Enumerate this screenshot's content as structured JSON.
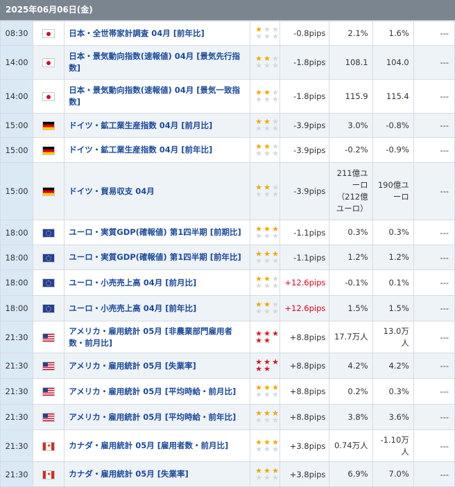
{
  "date_header": "2025年06月06日(金)",
  "colors": {
    "header_bg": "#7b8590",
    "time_bg": "#dbe9f5",
    "link": "#1a4a9c",
    "star": "#f0a800",
    "star_hot": "#d9121f",
    "positive_pips": "#e0001b"
  },
  "rows": [
    {
      "time": "08:30",
      "flag": "japan-flag-icon",
      "event": "日本・全世帯家計調査 04月 [前年比]",
      "stars": 1,
      "hot": false,
      "pips": "-0.8pips",
      "pips_up": false,
      "actual": "2.1%",
      "forecast": "1.6%",
      "prev": "---"
    },
    {
      "time": "14:00",
      "flag": "japan-flag-icon",
      "event": "日本・景気動向指数(速報値) 04月 [景気先行指数]",
      "stars": 2,
      "hot": false,
      "pips": "-1.8pips",
      "pips_up": false,
      "actual": "108.1",
      "forecast": "104.0",
      "prev": "---"
    },
    {
      "time": "14:00",
      "flag": "japan-flag-icon",
      "event": "日本・景気動向指数(速報値) 04月 [景気一致指数]",
      "stars": 2,
      "hot": false,
      "pips": "-1.8pips",
      "pips_up": false,
      "actual": "115.9",
      "forecast": "115.4",
      "prev": "---"
    },
    {
      "time": "15:00",
      "flag": "germany-flag-icon",
      "event": "ドイツ・鉱工業生産指数 04月 [前月比]",
      "stars": 2,
      "hot": false,
      "pips": "-3.9pips",
      "pips_up": false,
      "actual": "3.0%",
      "forecast": "-0.8%",
      "prev": "---"
    },
    {
      "time": "15:00",
      "flag": "germany-flag-icon",
      "event": "ドイツ・鉱工業生産指数 04月 [前年比]",
      "stars": 2,
      "hot": false,
      "pips": "-3.9pips",
      "pips_up": false,
      "actual": "-0.2%",
      "forecast": "-0.9%",
      "prev": "---"
    },
    {
      "time": "15:00",
      "flag": "germany-flag-icon",
      "event": "ドイツ・貿易収支 04月",
      "stars": 2,
      "hot": false,
      "pips": "-3.9pips",
      "pips_up": false,
      "actual": "211億ユーロ（212億ユーロ）",
      "forecast": "190億ユーロ",
      "prev": "---"
    },
    {
      "time": "18:00",
      "flag": "eu-flag-icon",
      "event": "ユーロ・実質GDP(確報値) 第1四半期 [前期比]",
      "stars": 3,
      "hot": false,
      "pips": "-1.1pips",
      "pips_up": false,
      "actual": "0.3%",
      "forecast": "0.3%",
      "prev": "---"
    },
    {
      "time": "18:00",
      "flag": "eu-flag-icon",
      "event": "ユーロ・実質GDP(確報値) 第1四半期 [前年比]",
      "stars": 3,
      "hot": false,
      "pips": "-1.1pips",
      "pips_up": false,
      "actual": "1.2%",
      "forecast": "1.2%",
      "prev": "---"
    },
    {
      "time": "18:00",
      "flag": "eu-flag-icon",
      "event": "ユーロ・小売売上高 04月 [前月比]",
      "stars": 2,
      "hot": false,
      "pips": "+12.6pips",
      "pips_up": true,
      "actual": "-0.1%",
      "forecast": "0.1%",
      "prev": "---"
    },
    {
      "time": "18:00",
      "flag": "eu-flag-icon",
      "event": "ユーロ・小売売上高 04月 [前年比]",
      "stars": 2,
      "hot": false,
      "pips": "+12.6pips",
      "pips_up": true,
      "actual": "1.5%",
      "forecast": "1.5%",
      "prev": "---"
    },
    {
      "time": "21:30",
      "flag": "usa-flag-icon",
      "event": "アメリカ・雇用統計 05月 [非農業部門雇用者数・前月比]",
      "stars": 5,
      "hot": true,
      "pips": "+8.8pips",
      "pips_up": false,
      "actual": "17.7万人",
      "forecast": "13.0万人",
      "prev": "---"
    },
    {
      "time": "21:30",
      "flag": "usa-flag-icon",
      "event": "アメリカ・雇用統計 05月 [失業率]",
      "stars": 5,
      "hot": true,
      "pips": "+8.8pips",
      "pips_up": false,
      "actual": "4.2%",
      "forecast": "4.2%",
      "prev": "---"
    },
    {
      "time": "21:30",
      "flag": "usa-flag-icon",
      "event": "アメリカ・雇用統計 05月 [平均時給・前月比]",
      "stars": 3,
      "hot": false,
      "pips": "+8.8pips",
      "pips_up": false,
      "actual": "0.2%",
      "forecast": "0.3%",
      "prev": "---"
    },
    {
      "time": "21:30",
      "flag": "usa-flag-icon",
      "event": "アメリカ・雇用統計 05月 [平均時給・前年比]",
      "stars": 3,
      "hot": false,
      "pips": "+8.8pips",
      "pips_up": false,
      "actual": "3.8%",
      "forecast": "3.6%",
      "prev": "---"
    },
    {
      "time": "21:30",
      "flag": "canada-flag-icon",
      "event": "カナダ・雇用統計 05月 [雇用者数・前月比]",
      "stars": 3,
      "hot": false,
      "pips": "+3.8pips",
      "pips_up": false,
      "actual": "0.74万人",
      "forecast": "-1.10万人",
      "prev": "---"
    },
    {
      "time": "21:30",
      "flag": "canada-flag-icon",
      "event": "カナダ・雇用統計 05月 [失業率]",
      "stars": 3,
      "hot": false,
      "pips": "+3.8pips",
      "pips_up": false,
      "actual": "6.9%",
      "forecast": "7.0%",
      "prev": "---"
    }
  ]
}
